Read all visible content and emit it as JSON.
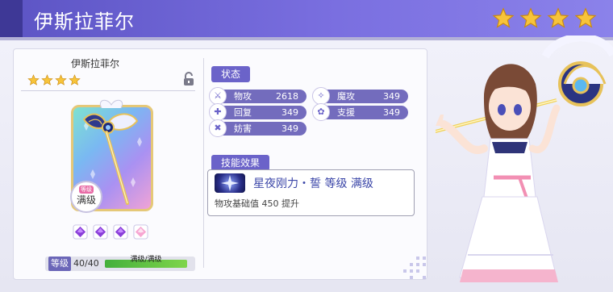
{
  "header": {
    "title": "伊斯拉菲尔",
    "star_count": 4
  },
  "item": {
    "name": "伊斯拉菲尔",
    "star_count": 4,
    "lock_icon": "lock-icon",
    "level_badge": {
      "top": "等级",
      "main": "满级"
    },
    "gems": [
      "purple-gem-icon",
      "purple-gem-icon",
      "purple-gem-icon",
      "pink-gem-icon"
    ],
    "level": {
      "label": "等级",
      "value": "40/40",
      "bar_text": "满级/满级",
      "fill": 1.0
    }
  },
  "status": {
    "title": "状态",
    "stats": [
      {
        "label": "物攻",
        "value": "2618",
        "icon": "sword-icon"
      },
      {
        "label": "魔攻",
        "value": "349",
        "icon": "magic-wand-icon"
      },
      {
        "label": "回复",
        "value": "349",
        "icon": "heal-icon"
      },
      {
        "label": "支援",
        "value": "349",
        "icon": "support-icon"
      },
      {
        "label": "妨害",
        "value": "349",
        "icon": "debuff-icon"
      }
    ]
  },
  "skill": {
    "title": "技能效果",
    "name": "星夜刚力・誓 等级 满级",
    "description": "物攻基础值 450 提升",
    "icon": "star-burst-icon"
  },
  "colors": {
    "accent": "#6b63c9",
    "header": "#6b64d4",
    "star": "#f7c43a"
  }
}
